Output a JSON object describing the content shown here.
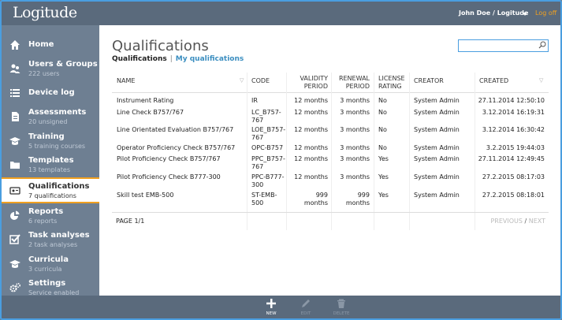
{
  "app": {
    "logo": "Logitude"
  },
  "header": {
    "user": "John Doe / Logitude",
    "logoff": "Log off"
  },
  "sidebar": {
    "items": [
      {
        "label": "Home",
        "sub": "",
        "icon": "home-icon"
      },
      {
        "label": "Users & Groups",
        "sub": "222 users",
        "icon": "users-icon"
      },
      {
        "label": "Device log",
        "sub": "",
        "icon": "list-icon"
      },
      {
        "label": "Assessments",
        "sub": "20 unsigned",
        "icon": "document-icon"
      },
      {
        "label": "Training",
        "sub": "5 training courses",
        "icon": "graduation-cap-icon"
      },
      {
        "label": "Templates",
        "sub": "13 templates",
        "icon": "folder-icon"
      },
      {
        "label": "Qualifications",
        "sub": "7 qualifications",
        "icon": "id-card-icon",
        "active": true
      },
      {
        "label": "Reports",
        "sub": "6 reports",
        "icon": "pie-chart-icon"
      },
      {
        "label": "Task analyses",
        "sub": "2 task analyses",
        "icon": "checkbox-icon"
      },
      {
        "label": "Curricula",
        "sub": "3 curricula",
        "icon": "graduation-cap-icon"
      },
      {
        "label": "Settings",
        "sub": "Service enabled",
        "icon": "gears-icon"
      }
    ]
  },
  "main": {
    "title": "Qualifications",
    "tabs": {
      "active": "Qualifications",
      "separator": "|",
      "other": "My qualifications"
    },
    "search": {
      "value": "",
      "placeholder": ""
    },
    "table": {
      "headers": {
        "name": "NAME",
        "code": "CODE",
        "validity": [
          "VALIDITY",
          "PERIOD"
        ],
        "renewal": [
          "RENEWAL",
          "PERIOD"
        ],
        "license": [
          "LICENSE",
          "RATING"
        ],
        "creator": "CREATOR",
        "created": "CREATED"
      },
      "rows": [
        {
          "name": "Instrument Rating",
          "code": [
            "IR"
          ],
          "validity": [
            "12 months"
          ],
          "renewal": [
            "3 months"
          ],
          "license": "No",
          "creator": "System Admin",
          "created": "27.11.2014 12:50:10"
        },
        {
          "name": "Line Check B757/767",
          "code": [
            "LC_B757-",
            "767"
          ],
          "validity": [
            "12 months"
          ],
          "renewal": [
            "3 months"
          ],
          "license": "No",
          "creator": "System Admin",
          "created": "3.12.2014 16:19:31"
        },
        {
          "name": "Line Orientated Evaluation B757/767",
          "code": [
            "LOE_B757-",
            "767"
          ],
          "validity": [
            "12 months"
          ],
          "renewal": [
            "3 months"
          ],
          "license": "No",
          "creator": "System Admin",
          "created": "3.12.2014 16:30:42"
        },
        {
          "name": "Operator Proficiency Check B757/767",
          "code": [
            "OPC-B757"
          ],
          "validity": [
            "12 months"
          ],
          "renewal": [
            "3 months"
          ],
          "license": "No",
          "creator": "System Admin",
          "created": "3.2.2015 19:44:03"
        },
        {
          "name": "Pilot Proficiency Check B757/767",
          "code": [
            "PPC_B757-",
            "767"
          ],
          "validity": [
            "12 months"
          ],
          "renewal": [
            "3 months"
          ],
          "license": "Yes",
          "creator": "System Admin",
          "created": "27.11.2014 12:49:45"
        },
        {
          "name": "Pilot Proficiency Check B777-300",
          "code": [
            "PPC-B777-",
            "300"
          ],
          "validity": [
            "12 months"
          ],
          "renewal": [
            "3 months"
          ],
          "license": "Yes",
          "creator": "System Admin",
          "created": "27.2.2015 08:17:03"
        },
        {
          "name": "Skill test EMB-500",
          "code": [
            "ST-EMB-",
            "500"
          ],
          "validity": [
            "999",
            "months"
          ],
          "renewal": [
            "999",
            "months"
          ],
          "license": "Yes",
          "creator": "System Admin",
          "created": "27.2.2015 08:18:01"
        }
      ]
    },
    "pagination": {
      "info": "PAGE 1/1",
      "previous": "PREVIOUS",
      "sep": "/",
      "next": "NEXT"
    }
  },
  "toolbar": {
    "new": {
      "label": "NEW",
      "icon": "plus-icon"
    },
    "edit": {
      "label": "EDIT",
      "icon": "pencil-icon"
    },
    "delete": {
      "label": "DELETE",
      "icon": "trash-icon"
    }
  },
  "colors": {
    "accent": "#f0a020",
    "link": "#3b8ec0",
    "sidebar": "#6e7f92",
    "topbar": "#5a6a7c"
  }
}
